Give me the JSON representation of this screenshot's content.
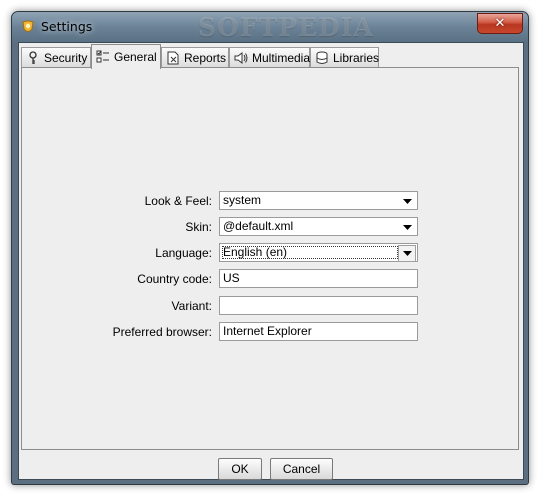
{
  "window": {
    "title": "Settings",
    "watermark": "SOFTPEDIA",
    "close_glyph": "✕"
  },
  "tabs": [
    {
      "label": "Security",
      "icon": "key-icon",
      "active": false
    },
    {
      "label": "General",
      "icon": "checklist-icon",
      "active": true
    },
    {
      "label": "Reports",
      "icon": "report-icon",
      "active": false
    },
    {
      "label": "Multimedia",
      "icon": "speaker-icon",
      "active": false
    },
    {
      "label": "Libraries",
      "icon": "database-icon",
      "active": false
    }
  ],
  "form": {
    "look_and_feel": {
      "label": "Look & Feel:",
      "value": "system"
    },
    "skin": {
      "label": "Skin:",
      "value": "@default.xml"
    },
    "language": {
      "label": "Language:",
      "value": "English (en)"
    },
    "country_code": {
      "label": "Country code:",
      "value": "US"
    },
    "variant": {
      "label": "Variant:",
      "value": ""
    },
    "preferred_browser": {
      "label": "Preferred browser:",
      "value": "Internet Explorer"
    }
  },
  "buttons": {
    "ok": "OK",
    "cancel": "Cancel"
  },
  "colors": {
    "titlebar": "#6c8397",
    "close": "#c9472e",
    "panel": "#eeeeee"
  }
}
